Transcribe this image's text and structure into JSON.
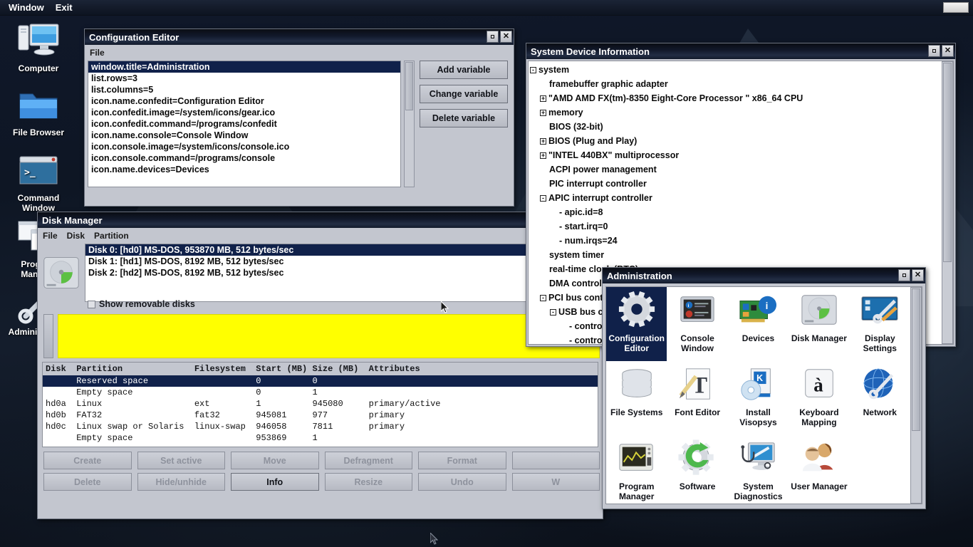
{
  "menubar": {
    "items": [
      "Window",
      "Exit"
    ],
    "task_tile": ""
  },
  "desktop_icons": [
    {
      "name": "Computer",
      "icon": "computer-icon",
      "label": "Computer"
    },
    {
      "name": "File Browser",
      "icon": "folder-icon",
      "label": "File Browser"
    },
    {
      "name": "Command Window",
      "icon": "console-icon",
      "label": "Command Window"
    },
    {
      "name": "Program Manager",
      "icon": "windows-icon",
      "label": "Program Manager"
    },
    {
      "name": "Administration",
      "icon": "wrench-icon",
      "label": "Administration"
    }
  ],
  "config_editor": {
    "title": "Configuration Editor",
    "menu": [
      "File"
    ],
    "min_label": "",
    "close_label": "✕",
    "variables": [
      "window.title=Administration",
      "list.rows=3",
      "list.columns=5",
      "icon.name.confedit=Configuration Editor",
      "icon.confedit.image=/system/icons/gear.ico",
      "icon.confedit.command=/programs/confedit",
      "icon.name.console=Console Window",
      "icon.console.image=/system/icons/console.ico",
      "icon.console.command=/programs/console",
      "icon.name.devices=Devices"
    ],
    "selected_index": 0,
    "buttons": [
      "Add variable",
      "Change variable",
      "Delete variable"
    ]
  },
  "system_device_info": {
    "title": "System Device Information",
    "min_label": "",
    "close_label": "✕",
    "tree": [
      {
        "indent": 0,
        "toggle": "-",
        "text": "system"
      },
      {
        "indent": 1,
        "toggle": "",
        "text": "framebuffer graphic adapter"
      },
      {
        "indent": 1,
        "toggle": "+",
        "text": "\"AMD AMD FX(tm)-8350 Eight-Core Processor \" x86_64 CPU"
      },
      {
        "indent": 1,
        "toggle": "+",
        "text": "memory"
      },
      {
        "indent": 1,
        "toggle": "",
        "text": "BIOS (32-bit)"
      },
      {
        "indent": 1,
        "toggle": "+",
        "text": "BIOS (Plug and Play)"
      },
      {
        "indent": 1,
        "toggle": "+",
        "text": "\"INTEL 440BX\" multiprocessor"
      },
      {
        "indent": 1,
        "toggle": "",
        "text": "ACPI power management"
      },
      {
        "indent": 1,
        "toggle": "",
        "text": "PIC interrupt controller"
      },
      {
        "indent": 1,
        "toggle": "-",
        "text": "APIC interrupt controller"
      },
      {
        "indent": 2,
        "toggle": "",
        "text": "- apic.id=8"
      },
      {
        "indent": 2,
        "toggle": "",
        "text": "- start.irq=0"
      },
      {
        "indent": 2,
        "toggle": "",
        "text": "- num.irqs=24"
      },
      {
        "indent": 1,
        "toggle": "",
        "text": "system timer"
      },
      {
        "indent": 1,
        "toggle": "",
        "text": "real-time clock (RTC)"
      },
      {
        "indent": 1,
        "toggle": "",
        "text": "DMA controller"
      },
      {
        "indent": 1,
        "toggle": "-",
        "text": "PCI bus controller"
      },
      {
        "indent": 2,
        "toggle": "-",
        "text": "USB bus controller"
      },
      {
        "indent": 3,
        "toggle": "",
        "text": "- controller"
      },
      {
        "indent": 3,
        "toggle": "",
        "text": "- controller"
      }
    ]
  },
  "disk_manager": {
    "title": "Disk Manager",
    "min_label": "",
    "close_label": "✕",
    "menu": [
      "File",
      "Disk",
      "Partition"
    ],
    "disks": [
      "Disk 0: [hd0] MS-DOS, 953870 MB, 512 bytes/sec",
      "Disk 1: [hd1] MS-DOS, 8192 MB, 512 bytes/sec",
      "Disk 2: [hd2] MS-DOS, 8192 MB, 512 bytes/sec"
    ],
    "selected_disk_index": 0,
    "show_removable_label": "Show removable disks",
    "show_removable_checked": false,
    "graph_color": "#ffff00",
    "table": {
      "header": "Disk  Partition              Filesystem  Start (MB) Size (MB)  Attributes",
      "rows": [
        {
          "text": "      Reserved space                     0          0",
          "selected": true
        },
        {
          "text": "      Empty space                        0          1",
          "selected": false
        },
        {
          "text": "hd0a  Linux                  ext         1          945080     primary/active",
          "selected": false
        },
        {
          "text": "hd0b  FAT32                  fat32       945081     977        primary",
          "selected": false
        },
        {
          "text": "hd0c  Linux swap or Solaris  linux-swap  946058     7811       primary",
          "selected": false
        },
        {
          "text": "      Empty space                        953869     1",
          "selected": false
        }
      ]
    },
    "buttons_row1": [
      "Create",
      "Set active",
      "Move",
      "Defragment",
      "Format",
      ""
    ],
    "buttons_row2": [
      "Delete",
      "Hide/unhide",
      "Info",
      "Resize",
      "Undo",
      "W"
    ],
    "enabled_button": "Info"
  },
  "administration": {
    "title": "Administration",
    "min_label": "",
    "close_label": "✕",
    "selected_index": 0,
    "items": [
      {
        "label": "Configuration Editor",
        "icon": "gear-icon"
      },
      {
        "label": "Console Window",
        "icon": "console-icon"
      },
      {
        "label": "Devices",
        "icon": "pci-card-icon"
      },
      {
        "label": "Disk Manager",
        "icon": "harddisk-icon"
      },
      {
        "label": "Display Settings",
        "icon": "display-tools-icon"
      },
      {
        "label": "File Systems",
        "icon": "database-stack-icon"
      },
      {
        "label": "Font Editor",
        "icon": "font-pencil-icon"
      },
      {
        "label": "Install Visopsys",
        "icon": "cd-box-icon"
      },
      {
        "label": "Keyboard Mapping",
        "icon": "keycap-icon"
      },
      {
        "label": "Network",
        "icon": "globe-wrench-icon"
      },
      {
        "label": "Program Manager",
        "icon": "monitor-graph-icon"
      },
      {
        "label": "Software",
        "icon": "gear-refresh-icon"
      },
      {
        "label": "System Diagnostics",
        "icon": "stethoscope-monitor-icon"
      },
      {
        "label": "User Manager",
        "icon": "users-icon"
      }
    ]
  },
  "colors": {
    "selection": "#10214a",
    "window_face": "#c3c6cf",
    "graph_yellow": "#ffff00",
    "titlebar_dark": "#0a0d14"
  }
}
